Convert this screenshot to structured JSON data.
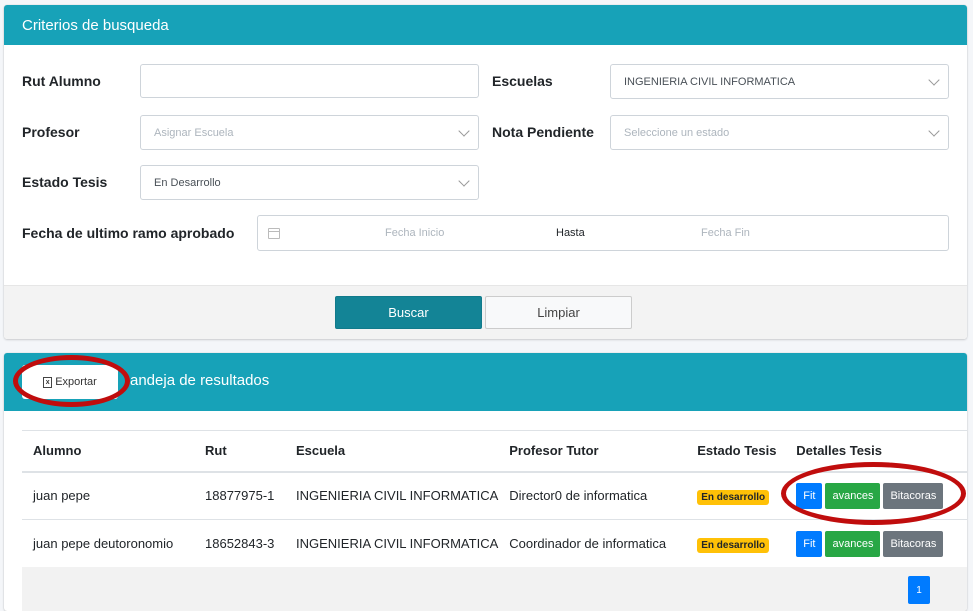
{
  "search": {
    "title": "Criterios de busqueda",
    "rut_label": "Rut Alumno",
    "rut_value": "",
    "escuelas_label": "Escuelas",
    "escuelas_value": "INGENIERIA CIVIL INFORMATICA",
    "profesor_label": "Profesor",
    "profesor_placeholder": "Asignar Escuela",
    "nota_label": "Nota Pendiente",
    "nota_placeholder": "Seleccione un estado",
    "estado_label": "Estado Tesis",
    "estado_value": "En Desarrollo",
    "fecha_label": "Fecha de ultimo ramo aprobado",
    "fecha_inicio": "Fecha Inicio",
    "hasta": "Hasta",
    "fecha_fin": "Fecha Fin",
    "buscar": "Buscar",
    "limpiar": "Limpiar"
  },
  "results": {
    "export_label": "Exportar",
    "title": "andeja de resultados",
    "columns": [
      "Alumno",
      "Rut",
      "Escuela",
      "Profesor Tutor",
      "Estado Tesis",
      "Detalles Tesis"
    ],
    "rows": [
      {
        "alumno": "juan pepe",
        "rut": "18877975-1",
        "escuela": "INGENIERIA CIVIL INFORMATICA",
        "tutor": "Director0 de informatica",
        "estado": "En desarrollo"
      },
      {
        "alumno": "juan pepe deutoronomio",
        "rut": "18652843-3",
        "escuela": "INGENIERIA CIVIL INFORMATICA",
        "tutor": "Coordinador de informatica",
        "estado": "En desarrollo"
      }
    ],
    "actions": {
      "fit": "Fit",
      "avances": "avances",
      "bitacoras": "Bitacoras"
    },
    "page": "1"
  },
  "colors": {
    "header": "#17a2b8",
    "highlight": "#c00d0d",
    "badge": "#ffc107"
  },
  "icons": {
    "calendar": "calendar-icon",
    "excel": "excel-icon",
    "chevron": "chevron-down-icon"
  }
}
